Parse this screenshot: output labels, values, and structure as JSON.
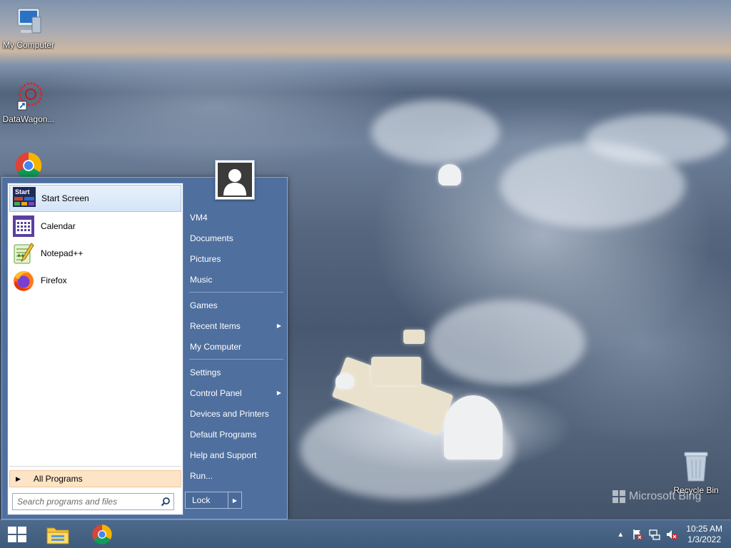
{
  "desktop": {
    "icons": [
      {
        "label": "My Computer",
        "icon": "computer-icon"
      },
      {
        "label": "DataWagon...",
        "icon": "datawagon-shortcut-icon"
      },
      {
        "label": "",
        "icon": "chrome-icon"
      },
      {
        "label": "Recycle Bin",
        "icon": "recycle-bin-icon"
      }
    ],
    "watermark": "Microsoft Bing"
  },
  "start_menu": {
    "pinned": [
      {
        "label": "Start Screen",
        "icon": "start-screen-icon",
        "badge": "Start",
        "selected": true
      },
      {
        "label": "Calendar",
        "icon": "calendar-icon"
      },
      {
        "label": "Notepad++",
        "icon": "notepadpp-icon"
      },
      {
        "label": "Firefox",
        "icon": "firefox-icon"
      }
    ],
    "all_programs": "All Programs",
    "search_placeholder": "Search programs and files",
    "right_items": [
      {
        "label": "VM4"
      },
      {
        "label": "Documents"
      },
      {
        "label": "Pictures"
      },
      {
        "label": "Music"
      },
      {
        "label": "Games"
      },
      {
        "label": "Recent Items",
        "submenu": true
      },
      {
        "label": "My Computer"
      },
      {
        "label": "Settings"
      },
      {
        "label": "Control Panel",
        "submenu": true
      },
      {
        "label": "Devices and Printers"
      },
      {
        "label": "Default Programs"
      },
      {
        "label": "Help and Support"
      },
      {
        "label": "Run..."
      }
    ],
    "lock_label": "Lock",
    "user_icon": "user-avatar-icon"
  },
  "taskbar": {
    "buttons": [
      {
        "name": "start-button",
        "icon": "windows-logo-icon"
      },
      {
        "name": "file-explorer",
        "icon": "folder-icon"
      },
      {
        "name": "chrome",
        "icon": "chrome-icon"
      }
    ],
    "tray": {
      "icons": [
        "chevron-up-icon",
        "action-center-flag-icon",
        "network-icon",
        "volume-muted-icon"
      ],
      "time": "10:25 AM",
      "date": "1/3/2022"
    }
  },
  "colors": {
    "start_menu_bg": "#4f6f9e",
    "all_programs_bg": "#fde4c6",
    "taskbar_bg": "#466282"
  }
}
